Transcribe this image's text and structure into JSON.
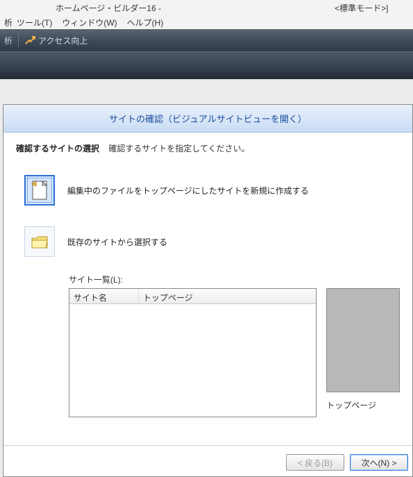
{
  "titlebar": {
    "app": "ホームページ・ビルダー16 -",
    "mode": "<標準モード>]"
  },
  "menubar": {
    "items": [
      "ツール(T)",
      "ウィンドウ(W)",
      "ヘルプ(H)"
    ],
    "left_fragment": "析"
  },
  "toolbar": {
    "access_up": "アクセス向上"
  },
  "dialog": {
    "title": "サイトの確認（ビジュアルサイトビューを開く）",
    "section_title": "確認するサイトの選択",
    "section_sub": "確認するサイトを指定してください。",
    "option1": "編集中のファイルをトップページにしたサイトを新規に作成する",
    "option2": "既存のサイトから選択する",
    "sitelist_label": "サイト一覧(L):",
    "columns": {
      "name": "サイト名",
      "top": "トップページ"
    },
    "preview_label": "トップページ",
    "buttons": {
      "back": "< 戻る(B)",
      "next": "次へ(N) >"
    }
  }
}
